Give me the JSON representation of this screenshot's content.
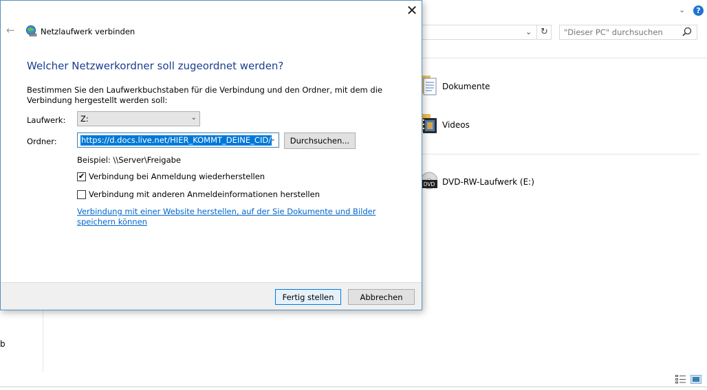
{
  "explorer": {
    "search": {
      "placeholder": "\"Dieser PC\" durchsuchen"
    },
    "items": [
      {
        "label": "Dokumente",
        "icon": "documents-folder-icon"
      },
      {
        "label": "Videos",
        "icon": "videos-folder-icon"
      },
      {
        "label": "DVD-RW-Laufwerk (E:)",
        "icon": "dvd-drive-icon"
      }
    ],
    "dvd_icon_text": "DVD",
    "left_text": "b",
    "help_glyph": "?"
  },
  "dialog": {
    "window_title": "Netzlaufwerk verbinden",
    "heading": "Welcher Netzwerkordner soll zugeordnet werden?",
    "instructions": "Bestimmen Sie den Laufwerkbuchstaben für die Verbindung und den Ordner, mit dem die Verbindung hergestellt werden soll:",
    "drive_label": "Laufwerk:",
    "drive_value": "Z:",
    "folder_label": "Ordner:",
    "folder_value": "https://d.docs.live.net/HIER_KOMMT_DEINE_CID/",
    "browse_button": "Durchsuchen...",
    "example": "Beispiel: \\\\Server\\Freigabe",
    "checkbox_reconnect": {
      "label": "Verbindung bei Anmeldung wiederherstellen",
      "checked": true
    },
    "checkbox_other_credentials": {
      "label": "Verbindung mit anderen Anmeldeinformationen herstellen",
      "checked": false
    },
    "website_link": "Verbindung mit einer Website herstellen, auf der Sie Dokumente und Bilder speichern können",
    "finish_button": "Fertig stellen",
    "cancel_button": "Abbrechen"
  },
  "colors": {
    "heading": "#1a3d8f",
    "link": "#0066cc",
    "selection": "#0078d7",
    "dialog_border": "#5a8fb8"
  }
}
